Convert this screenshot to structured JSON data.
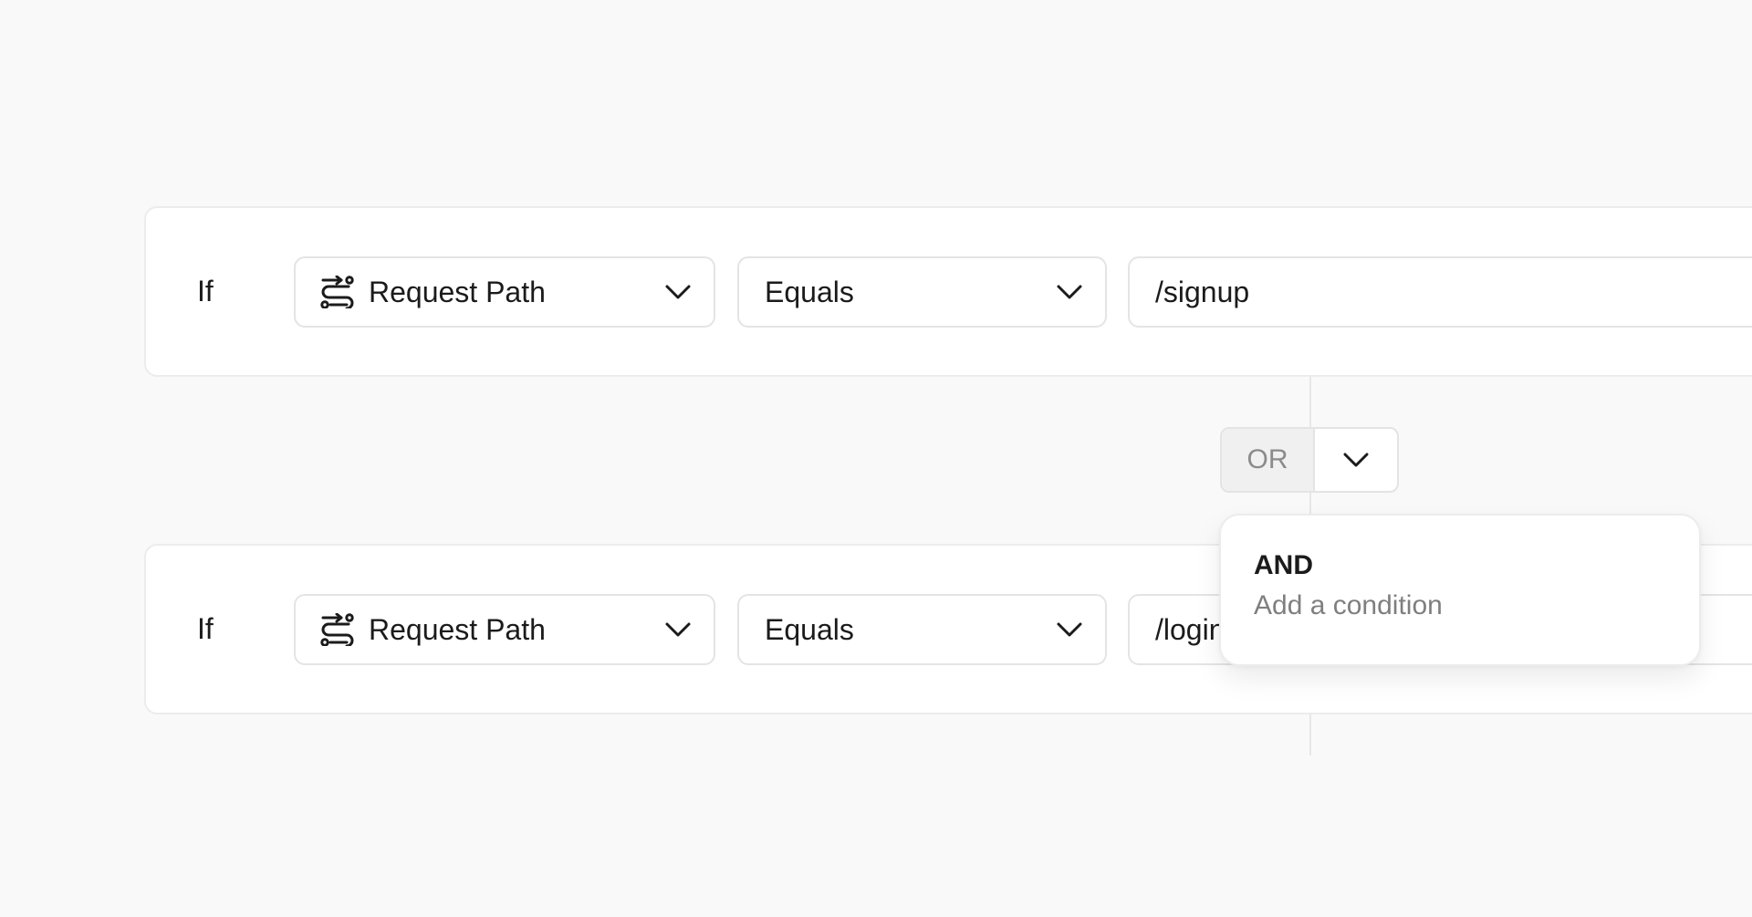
{
  "rules": [
    {
      "if_label": "If",
      "field": {
        "label": "Request Path",
        "icon": "route-icon"
      },
      "operator": {
        "label": "Equals"
      },
      "value": "/signup"
    },
    {
      "if_label": "If",
      "field": {
        "label": "Request Path",
        "icon": "route-icon"
      },
      "operator": {
        "label": "Equals"
      },
      "value": "/login"
    }
  ],
  "combinator": {
    "current": "OR",
    "toggle_icon": "chevron-down-icon"
  },
  "combinator_menu": {
    "options": [
      {
        "title": "AND",
        "description": "Add a condition"
      }
    ]
  },
  "colors": {
    "background": "#f9f9f9",
    "card": "#ffffff",
    "border": "#e4e4e4",
    "muted_text": "#7f7f7f",
    "text": "#1b1b1b"
  }
}
